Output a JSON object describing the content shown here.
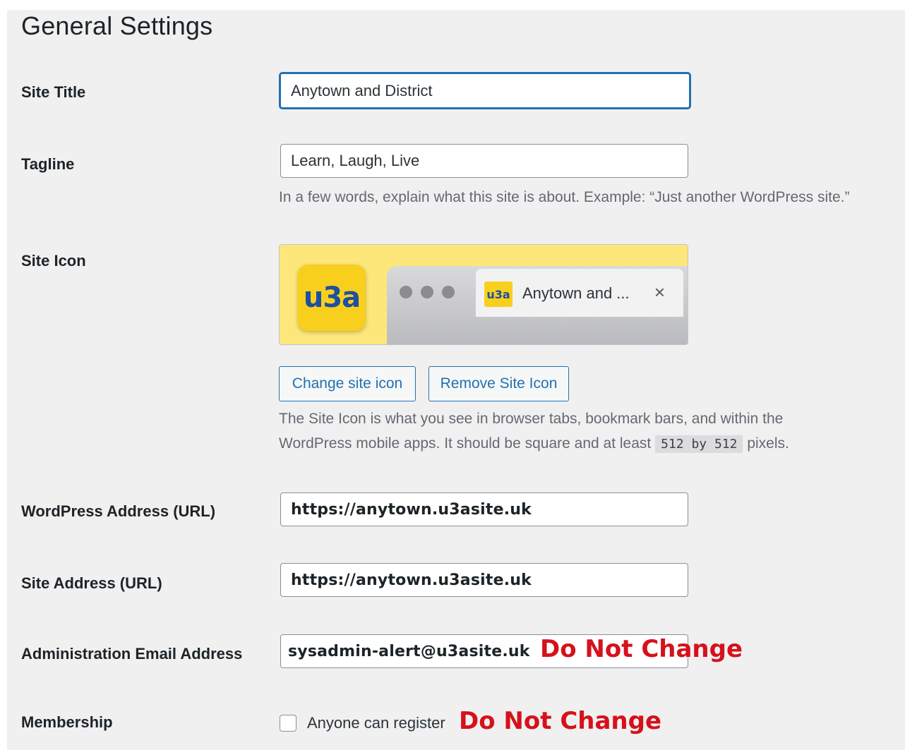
{
  "page": {
    "title": "General Settings"
  },
  "site_title": {
    "label": "Site Title",
    "value": "Anytown and District"
  },
  "tagline": {
    "label": "Tagline",
    "value": "Learn, Laugh, Live",
    "description": "In a few words, explain what this site is about. Example: “Just another WordPress site.”"
  },
  "site_icon": {
    "label": "Site Icon",
    "app_icon_text": "u3a",
    "favicon_text": "u3a",
    "tab_title": "Anytown and ...",
    "tab_close": "×",
    "change_button": "Change site icon",
    "remove_button": "Remove Site Icon",
    "description_line1": "The Site Icon is what you see in browser tabs, bookmark bars, and within the",
    "description_line2_prefix": "WordPress mobile apps. It should be square and at least",
    "description_code": "512 by 512",
    "description_line2_suffix": "pixels."
  },
  "wordpress_address": {
    "label": "WordPress Address (URL)",
    "value": "https://anytown.u3asite.uk"
  },
  "site_address": {
    "label": "Site Address (URL)",
    "value": "https://anytown.u3asite.uk"
  },
  "admin_email": {
    "label": "Administration Email Address",
    "value": "sysadmin-alert@u3asite.uk",
    "warning": "Do Not Change"
  },
  "membership": {
    "label": "Membership",
    "checkbox_label": "Anyone can register",
    "checked": false,
    "warning": "Do Not Change"
  },
  "colors": {
    "accent": "#2271b1",
    "warning": "#d6111c",
    "brand_yellow": "#f9cf1e",
    "brand_blue": "#1e4fa0"
  }
}
